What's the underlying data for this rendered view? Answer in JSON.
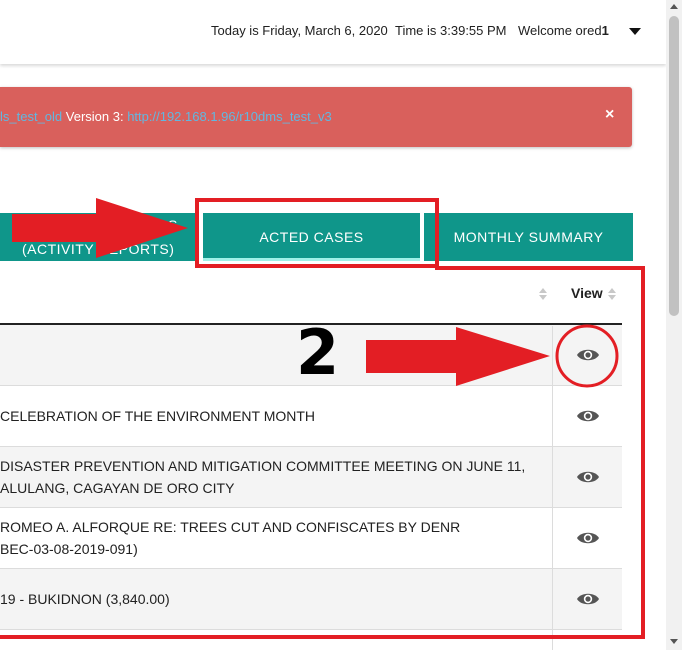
{
  "header": {
    "date_text": "Today is Friday, March 6, 2020",
    "time_text": "Time is 3:39:55 PM",
    "welcome_prefix": "Welcome ored",
    "welcome_suffix": "1"
  },
  "alert": {
    "link1": "ls_test_old",
    "text_mid": " Version 3: ",
    "link2": "http://192.168.1.96/r10dms_test_v3",
    "close": "×",
    "colors": {
      "background": "#d9605c",
      "link": "#62b7e0"
    }
  },
  "tabs": [
    {
      "line1": "S",
      "line2": "(ACTIVITY REPORTS)"
    },
    {
      "label": "ACTED CASES",
      "active": true
    },
    {
      "label": "MONTHLY SUMMARY"
    }
  ],
  "table": {
    "view_header": "View",
    "rows": [
      {
        "lines": [
          ""
        ]
      },
      {
        "lines": [
          "CELEBRATION OF THE ENVIRONMENT MONTH"
        ]
      },
      {
        "lines": [
          "DISASTER PREVENTION AND MITIGATION COMMITTEE MEETING ON JUNE 11,",
          "ALULANG, CAGAYAN DE ORO CITY"
        ]
      },
      {
        "lines": [
          "ROMEO A. ALFORQUE RE: TREES CUT AND CONFISCATES BY DENR",
          "BEC-03-08-2019-091)"
        ]
      },
      {
        "lines": [
          "19 - BUKIDNON (3,840.00)"
        ]
      }
    ]
  },
  "annotations": {
    "step_number": "2",
    "color": "#e31e24"
  },
  "colors": {
    "tab_bg": "#0f968a",
    "tab_active_underline": "#9ff1e8"
  },
  "icons": {
    "view": "eye-icon",
    "menu": "caret-down-icon",
    "close": "close-icon",
    "sort": "sort-icon"
  }
}
